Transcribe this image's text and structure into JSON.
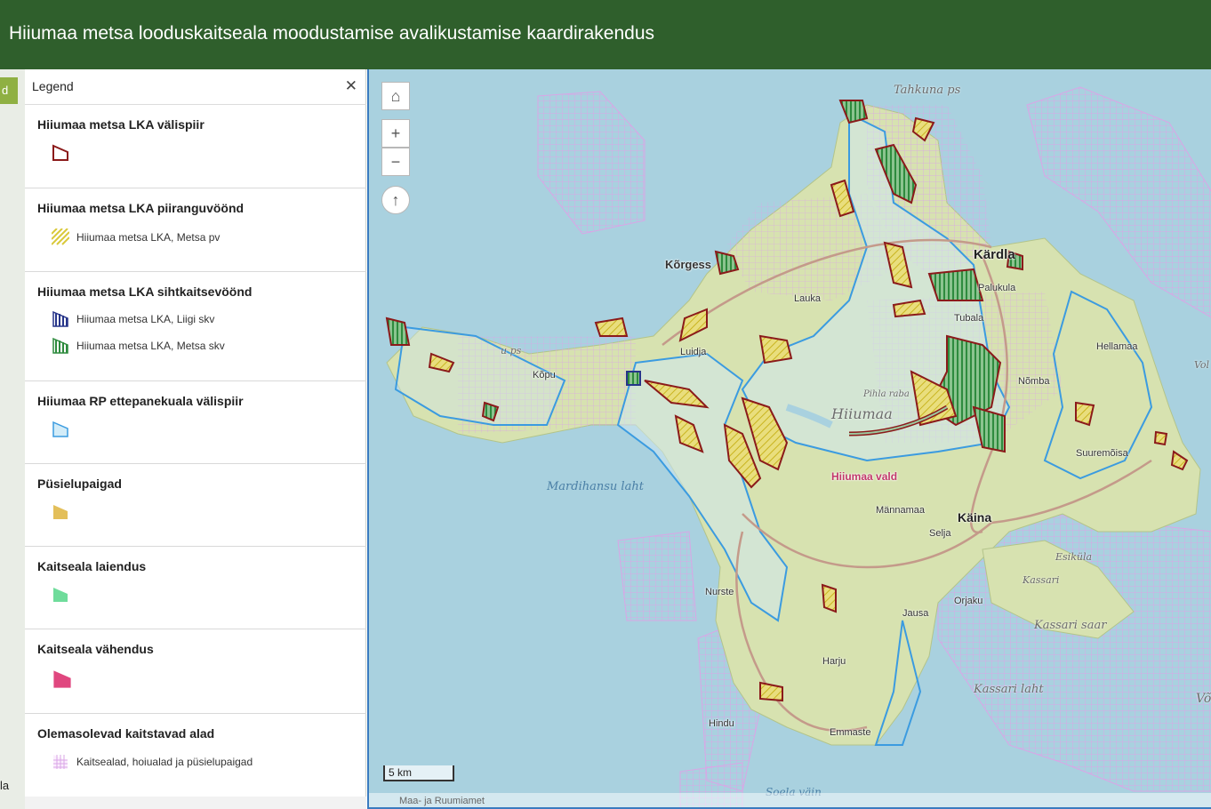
{
  "app": {
    "title": "Hiiumaa metsa looduskaitseala moodustamise avalikustamise kaardirakendus"
  },
  "side_strip": {
    "tab_label": "d",
    "bottom_label": "la"
  },
  "legend": {
    "title": "Legend",
    "close_icon": "close-icon",
    "sections": [
      {
        "title": "Hiiumaa metsa LKA välispiir",
        "items": [
          {
            "label": "",
            "color": "#8b1a1a",
            "fill": "none"
          }
        ]
      },
      {
        "title": "Hiiumaa metsa LKA piiranguvöönd",
        "items": [
          {
            "label": "Hiiumaa metsa LKA, Metsa pv",
            "color": "#d9c93a"
          }
        ]
      },
      {
        "title": "Hiiumaa metsa LKA sihtkaitsevöönd",
        "items": [
          {
            "label": "Hiiumaa metsa LKA, Liigi skv",
            "color": "#27358a"
          },
          {
            "label": "Hiiumaa metsa LKA, Metsa skv",
            "color": "#2e8b3e"
          }
        ]
      },
      {
        "title": "Hiiumaa RP ettepanekuala välispiir",
        "items": [
          {
            "label": "",
            "color": "#3b9be0"
          }
        ]
      },
      {
        "title": "Püsielupaigad",
        "items": [
          {
            "label": "",
            "color": "#e3bf5a"
          }
        ]
      },
      {
        "title": "Kaitseala laiendus",
        "items": [
          {
            "label": "",
            "color": "#6fdc9b"
          }
        ]
      },
      {
        "title": "Kaitseala vähendus",
        "items": [
          {
            "label": "",
            "color": "#e0477f"
          }
        ]
      },
      {
        "title": "Olemasolevad kaitstavad alad",
        "items": [
          {
            "label": "Kaitsealad, hoiualad ja püsielupaigad",
            "color": "#d9a6e6"
          }
        ]
      }
    ]
  },
  "map": {
    "controls": {
      "home_icon": "home-icon",
      "zoom_in": "+",
      "zoom_out": "−",
      "compass_icon": "compass-icon"
    },
    "scale_label": "5 km",
    "attribution": "Maa- ja Ruumiamet",
    "places": {
      "tahkuna": "Tahkuna ps",
      "kardla": "Kärdla",
      "korgessaare": "Kõrgess",
      "lauka": "Lauka",
      "palukula": "Palukula",
      "tubala": "Tubala",
      "luidja": "Luidja",
      "hellamaa": "Hellamaa",
      "nomba": "Nõmba",
      "kopu": "Kõpu",
      "kopu_ps": "u ps",
      "hiiumaa": "Hiiumaa",
      "hiiumaa_vald": "Hiiumaa vald",
      "suuremoisa": "Suuremõisa",
      "mardihansu": "Mardihansu laht",
      "mannamaa": "Männamaa",
      "kaina": "Käina",
      "selja": "Selja",
      "esikula": "Esiküla",
      "kassari": "Kassari",
      "orjaku": "Orjaku",
      "kassari_saar": "Kassari saar",
      "nurste": "Nurste",
      "jausa": "Jausa",
      "harju": "Harju",
      "kassari_laht": "Kassari laht",
      "hindu": "Hindu",
      "emmaste": "Emmaste",
      "soela": "Soela väin",
      "pihla": "Pihla raba",
      "vo": "Võ",
      "vol": "Vol"
    }
  }
}
